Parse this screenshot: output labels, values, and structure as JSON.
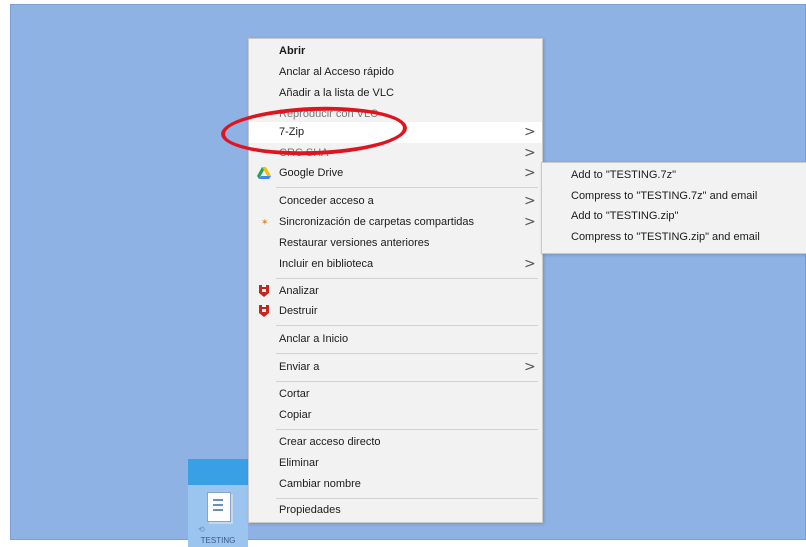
{
  "desktop": {
    "file_name": "TESTING",
    "background_color": "#8eb2e4"
  },
  "context_menu": {
    "items": [
      {
        "label": "Abrir"
      },
      {
        "label": "Anclar al Acceso rápido"
      },
      {
        "label": "Añadir a la lista de VLC"
      },
      {
        "label": "Reproducir con VLC"
      },
      {
        "label": "7-Zip",
        "submenu": true
      },
      {
        "label": "CRC SHA",
        "submenu": true
      },
      {
        "label": "Google Drive",
        "submenu": true,
        "icon": "google-drive-icon"
      },
      {
        "label": "Conceder acceso a",
        "submenu": true
      },
      {
        "label": "Sincronización de carpetas compartidas",
        "submenu": true,
        "icon": "sync-icon"
      },
      {
        "label": "Restaurar versiones anteriores"
      },
      {
        "label": "Incluir en biblioteca",
        "submenu": true
      },
      {
        "label": "Analizar",
        "icon": "antivirus-icon"
      },
      {
        "label": "Destruir",
        "icon": "antivirus-icon"
      },
      {
        "label": "Anclar a Inicio"
      },
      {
        "label": "Enviar a",
        "submenu": true
      },
      {
        "label": "Cortar"
      },
      {
        "label": "Copiar"
      },
      {
        "label": "Crear acceso directo"
      },
      {
        "label": "Eliminar"
      },
      {
        "label": "Cambiar nombre"
      },
      {
        "label": "Propiedades"
      }
    ],
    "chevron": ">"
  },
  "submenu_7zip": {
    "items": [
      {
        "label": "Add to \"TESTING.7z\""
      },
      {
        "label": "Compress to \"TESTING.7z\" and email"
      },
      {
        "label": "Add to \"TESTING.zip\""
      },
      {
        "label": "Compress to \"TESTING.zip\" and email"
      }
    ]
  },
  "annotation": {
    "color": "#e0141e",
    "target": "7-Zip"
  }
}
